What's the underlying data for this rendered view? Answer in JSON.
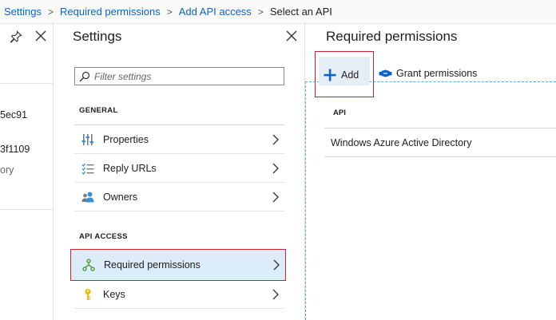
{
  "breadcrumb": {
    "items": [
      "Settings",
      "Required permissions",
      "Add API access"
    ],
    "current": "Select an API",
    "separator": ">"
  },
  "left_blade": {
    "texts": [
      "5ec91",
      "3f1109",
      "ory"
    ]
  },
  "settings": {
    "title": "Settings",
    "filter_placeholder": "Filter settings",
    "sections": [
      {
        "header": "GENERAL",
        "items": [
          {
            "label": "Properties",
            "icon": "properties-icon"
          },
          {
            "label": "Reply URLs",
            "icon": "reply-urls-icon"
          },
          {
            "label": "Owners",
            "icon": "owners-icon"
          }
        ]
      },
      {
        "header": "API ACCESS",
        "items": [
          {
            "label": "Required permissions",
            "icon": "permissions-icon",
            "selected": true
          },
          {
            "label": "Keys",
            "icon": "key-icon"
          }
        ]
      }
    ]
  },
  "permissions": {
    "title": "Required permissions",
    "add_label": "Add",
    "grant_label": "Grant permissions",
    "table_header": "API",
    "rows": [
      "Windows Azure Active Directory"
    ]
  },
  "colors": {
    "link": "#0a64c8",
    "highlight_border": "#c7212a",
    "selected_bg": "#dcecf9",
    "accent_blue": "#0078d4"
  }
}
